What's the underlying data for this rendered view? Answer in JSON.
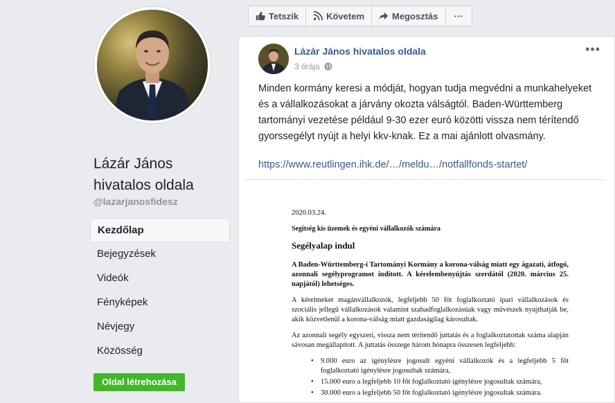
{
  "left": {
    "page_name_line1": "Lázár János",
    "page_name_line2": "hivatalos oldala",
    "handle": "@lazarjanosfidesz",
    "nav": [
      {
        "label": "Kezdőlap",
        "active": true
      },
      {
        "label": "Bejegyzések"
      },
      {
        "label": "Videók"
      },
      {
        "label": "Fényképek"
      },
      {
        "label": "Névjegy"
      },
      {
        "label": "Közösség"
      }
    ],
    "create_label": "Oldal létrehozása"
  },
  "actions": {
    "like": "Tetszik",
    "follow": "Követem",
    "share": "Megosztás",
    "more": "···"
  },
  "post": {
    "author": "Lázár János hivatalos oldala",
    "time": "3 órája",
    "more": "•••",
    "text": "Minden kormány keresi a módját, hogyan tudja megvédni a munkahelyeket és a vállalkozásokat a járvány okozta válságtól. Baden-Württemberg tartományi vezetése például 9-30 ezer euró közötti vissza nem térítendő gyorssegélyt nyújt a helyi kkv-knak. Ez a mai ajánlott olvasmány.",
    "link": "https://www.reutlingen.ihk.de/…/meldu…/notfallfonds-startet/"
  },
  "doc": {
    "date": "2020.03.24.",
    "subtitle": "Segítség kis üzemek és egyéni vállalkozók számára",
    "title": "Segélyalap indul",
    "para1": "A Baden-Württemberg-i Tartományi Kormány a korona-válság miatt egy ágazati, átfogó, azonnali segélyprogramot indított. A kérelembenyújtás szerdától (2020. március 25. napjától) lehetséges.",
    "para2": "A kérelmeket magánvállalkozók, legfeljebb 50 főt foglalkoztató ipari vállalkozások és szociális jellegű vállalkozások valamint szabadfoglalkozásúak vagy művészek nyújthatják be, akik közvetlenül a korona-válság miatt gazdaságilag károsultak.",
    "para3": "Az azonnali segély egyszeri, vissza nem térítendő juttatás és a foglalkoztatottak száma alapján sávosan megállapított. A juttatás összege három hónapra összesen legfeljebb:",
    "bullets": [
      "9.000 euro az igénylésre jogosult egyéni vállalkozók és a legfeljebb 5 főt foglalkoztató igénylésre jogosultak számára,",
      "15.000 euro a legfeljebb 10 főt foglalkoztató igénylésre jogosultak számára,",
      "30.000 euro a legfeljebb 50 főt foglalkoztató igénylésre jogosultak számára."
    ]
  }
}
